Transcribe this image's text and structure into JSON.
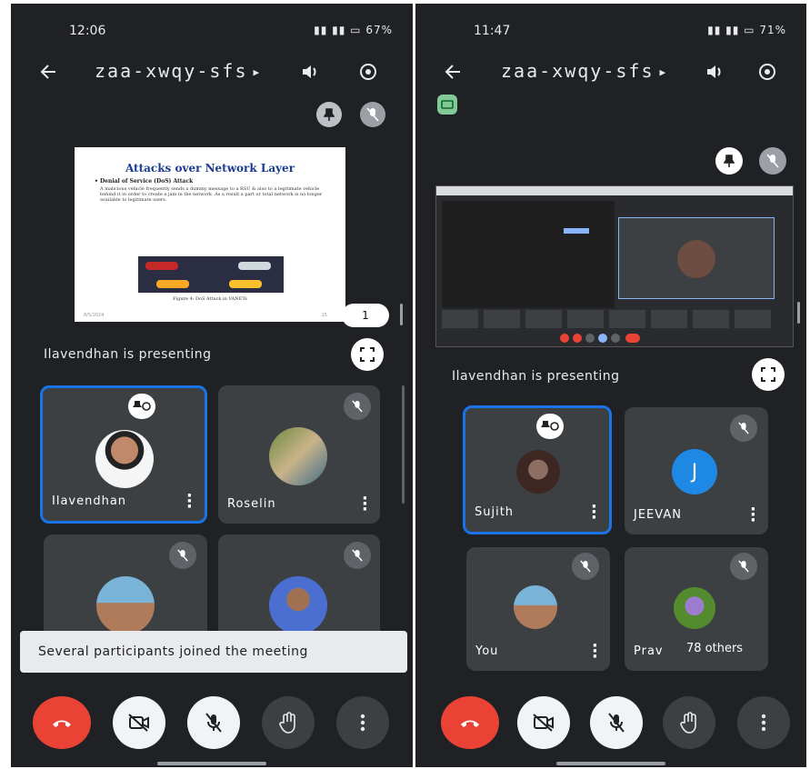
{
  "left": {
    "status": {
      "time": "12:06",
      "right": "67%"
    },
    "meeting_code": "zaa-xwqy-sfs",
    "slide": {
      "title": "Attacks over Network Layer",
      "bullet": "Denial of Service (DoS) Attack",
      "body": "A malicious vehicle frequently sends a dummy message to a RSU & also to a legitimate vehicle behind it in order to create a jam in the network. As a result a part or total network is no longer available to legitimate users.",
      "caption": "Figure 4: DoS Attack in VANETs",
      "footer": "8/5/2024",
      "page": "15"
    },
    "pager_label": "1",
    "presenting_text": "Ilavendhan is presenting",
    "tiles": [
      {
        "name": "Ilavendhan"
      },
      {
        "name": "Roselin"
      },
      {
        "name": ""
      },
      {
        "name": ""
      }
    ],
    "toast": "Several participants joined the meeting"
  },
  "right": {
    "status": {
      "time": "11:47",
      "right": "71%"
    },
    "meeting_code": "zaa-xwqy-sfs",
    "presenting_text": "Ilavendhan is presenting",
    "tiles": [
      {
        "name": "Sujith"
      },
      {
        "name": "JEEVAN",
        "initial": "J"
      },
      {
        "name": "You"
      },
      {
        "name": "Prav"
      }
    ],
    "others_label": "78 others"
  },
  "colors": {
    "background": "#202124",
    "tile": "#3c4043",
    "active_border": "#1a73e8",
    "end_call": "#ea4335",
    "jeevan_avatar": "#1e88e5"
  },
  "icons": [
    "back-arrow-icon",
    "speaker-icon",
    "switch-camera-icon",
    "pin-icon",
    "mic-off-icon",
    "fullscreen-icon",
    "end-call-icon",
    "camera-off-icon",
    "raise-hand-icon",
    "more-vert-icon"
  ]
}
